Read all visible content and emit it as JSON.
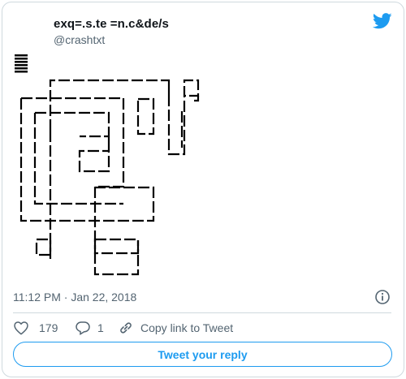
{
  "author": {
    "name": "exq=.s.te =n.c&de/s",
    "handle": "@crashtxt"
  },
  "tweet": {
    "text": "𝍖\n ▕▔▔▔▔▔▔▔▔▔▔▔▏ ▕▔▏\n▕▔▔▔▏▔▔▔▔▔▔▏ ▕▔▔▔▏▕▔▔\n ▕▕▔▔▔▔▔▔▏▏ ▕  ▏▕\n▕▕ ▕ ▔▔▔▏▏ ▔▔▔▔\n▕▕ ▕▔▔▔▏▏▏\n▕▕ ▔▔▔▔▕▔▔▔▔▔▔▏\n▕▔▔▔▔▔▔▔▔▔▔▔▔▏\n ▕▔▏▔▔▔▔▔▔▏\n ▔▔▔ ▕ ▏\n     ▔▔▔▔▔▏"
  },
  "timestamp": "11:12 PM · Jan 22, 2018",
  "actions": {
    "like_count": "179",
    "reply_count": "1",
    "copy_label": "Copy link to Tweet"
  },
  "reply_button_label": "Tweet your reply",
  "colors": {
    "brand_blue": "#1d9bf0",
    "secondary_text": "#536471",
    "border": "#cfd9de"
  },
  "icons": [
    "twitter-bird-icon",
    "info-icon",
    "heart-icon",
    "reply-bubble-icon",
    "link-icon"
  ]
}
